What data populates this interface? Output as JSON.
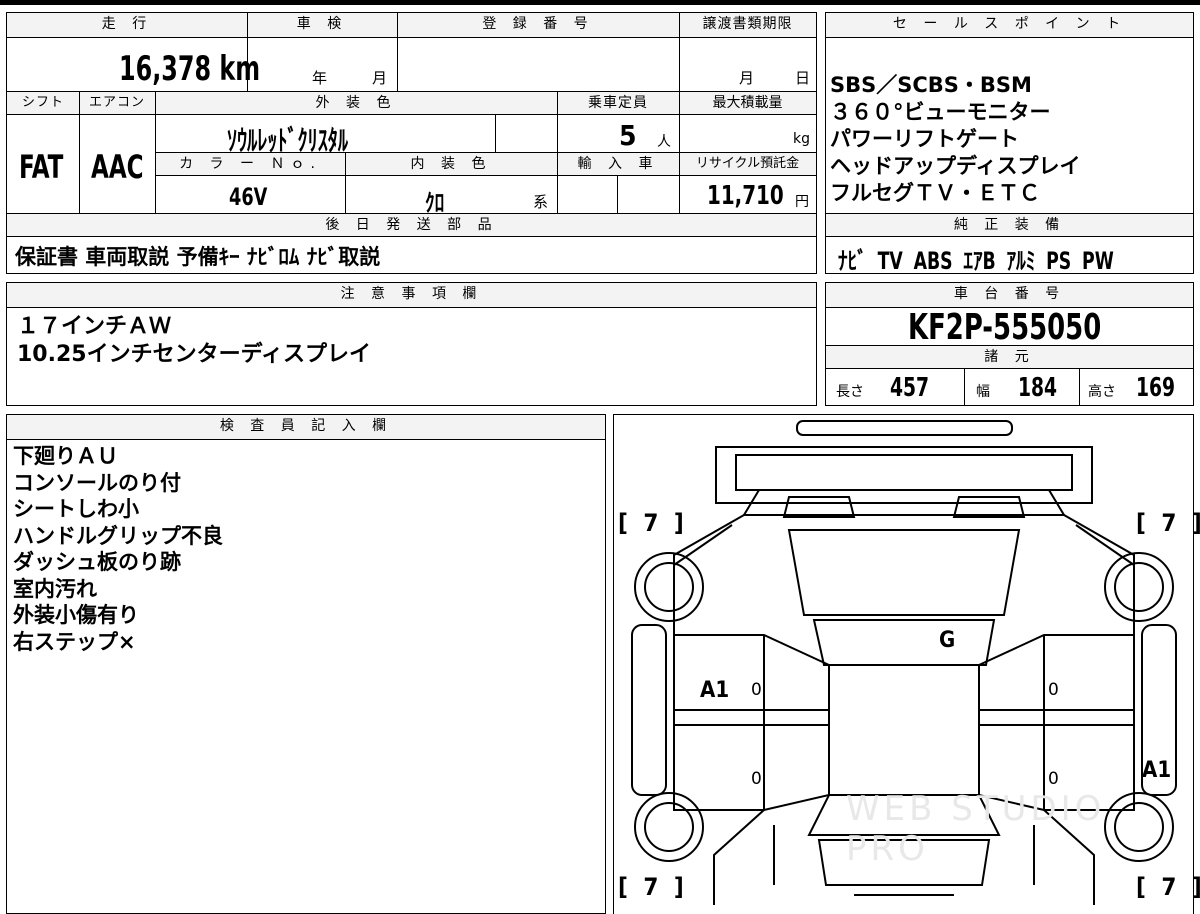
{
  "mileage": {
    "header": "走 行",
    "value": "16,378 km"
  },
  "shaken": {
    "header": "車 検",
    "year": "年",
    "month": "月"
  },
  "registration": {
    "header": "登 録 番 号"
  },
  "transfer": {
    "header": "譲渡書類期限",
    "month": "月",
    "day": "日"
  },
  "sales_points": {
    "header": "セ ー ル ス ポ イ ン ト",
    "lines": "SBS／SCBS・BSM\n３６０°ビューモニター\nパワーリフトゲート\nヘッドアップディスプレイ\nフルセグＴＶ・ＥＴＣ"
  },
  "shift": {
    "header": "シフト",
    "value": "FAT"
  },
  "aircon": {
    "header": "エアコン",
    "value": "AAC"
  },
  "exterior": {
    "header": "外 装 色",
    "value": "ｿｳﾙﾚｯﾄﾞｸﾘｽﾀﾙ"
  },
  "capacity": {
    "header": "乗車定員",
    "value": "5",
    "unit": "人"
  },
  "max_load": {
    "header": "最大積載量",
    "unit": "kg"
  },
  "color_no": {
    "header": "カ ラ ー Ｎｏ.",
    "value": "46V"
  },
  "interior": {
    "header": "内 装 色",
    "value": "ｸﾛ",
    "suffix": "系"
  },
  "import": {
    "header": "輸 入 車"
  },
  "recycle": {
    "header": "リサイクル預託金",
    "value": "11,710",
    "unit": "円"
  },
  "shipping": {
    "header": "後 日 発 送 部 品",
    "value": "保証書 車両取説 予備ｷｰ ﾅﾋﾞﾛﾑ ﾅﾋﾞ取説"
  },
  "equipment": {
    "header": "純 正 装 備",
    "value": "ﾅﾋﾞ TV ABS ｴｱB ｱﾙﾐ PS PW"
  },
  "notes": {
    "header": "注 意 事 項 欄",
    "lines": "１７インチＡＷ\n10.25インチセンターディスプレイ"
  },
  "chassis": {
    "header": "車 台 番 号",
    "value": "KF2P-555050"
  },
  "specs": {
    "header": "諸 元",
    "length_label": "長さ",
    "length": "457",
    "width_label": "幅",
    "width": "184",
    "height_label": "高さ",
    "height": "169"
  },
  "inspector": {
    "header": "検 査 員 記 入 欄",
    "lines": "下廻りＡＵ\nコンソールのり付\nシートしわ小\nハンドルグリップ不良\nダッシュ板のり跡\n室内汚れ\n外装小傷有り\n右ステップ×"
  },
  "diagram": {
    "tire_fl": "[ 7 ]",
    "tire_fr": "[ 7 ]",
    "tire_rl": "[ 7 ]",
    "tire_rr": "[ 7 ]",
    "mark_g": "G",
    "mark_a1_left": "A1",
    "mark_a1_right": "A1",
    "zero_1": "0",
    "zero_2": "0",
    "zero_3": "0",
    "zero_4": "0"
  },
  "watermark": "WEB STUDIO PRO"
}
